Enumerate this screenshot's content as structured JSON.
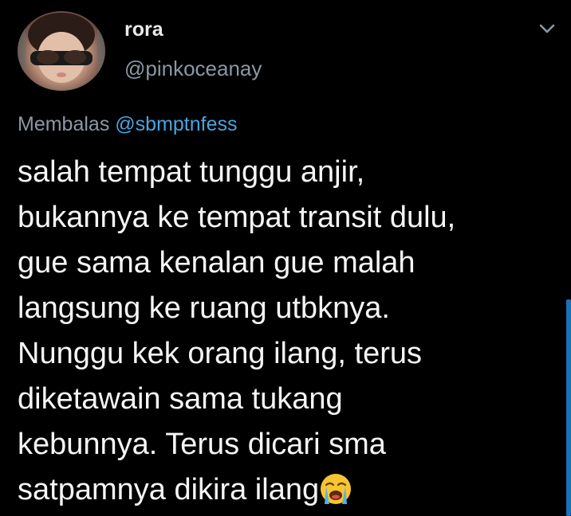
{
  "author": {
    "name": "rora",
    "handle": "@pinkoceanay"
  },
  "reply": {
    "prefix": "Membalas",
    "mention": "@sbmptnfess"
  },
  "tweet": {
    "lines": [
      "salah tempat tunggu anjir,",
      "bukannya ke tempat transit dulu,",
      "gue sama kenalan gue malah",
      "langsung ke ruang utbknya.",
      "Nunggu kek orang ilang, terus",
      "diketawain sama tukang",
      "kebunnya. Terus dicari sma",
      "satpamnya dikira ilang"
    ],
    "trailing_emoji": "loudly-crying-face-emoji"
  },
  "icons": {
    "menu": "chevron-down-icon",
    "avatar": "avatar"
  },
  "colors": {
    "background": "#000000",
    "name": "#e8eaed",
    "secondary": "#8b98a5",
    "mention": "#4aa3df",
    "scrollbar": "#1d6fb8"
  }
}
